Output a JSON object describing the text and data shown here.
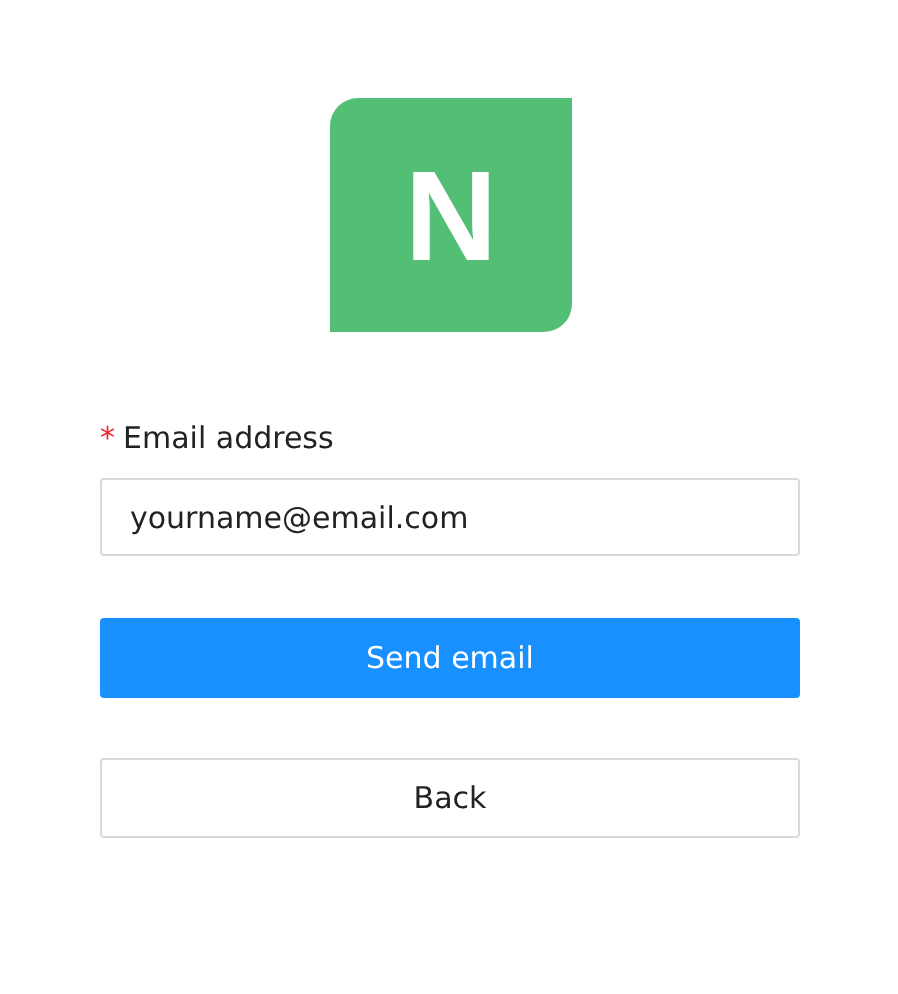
{
  "logo": {
    "letter": "N"
  },
  "email_field": {
    "label": "Email address",
    "required_mark": "*",
    "value": "yourname@email.com"
  },
  "buttons": [
    {
      "label": "Send email",
      "kind": "primary"
    },
    {
      "label": "Back",
      "kind": "default"
    }
  ]
}
